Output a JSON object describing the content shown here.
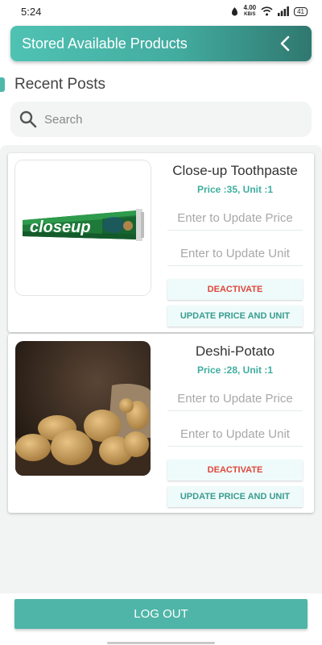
{
  "status_bar": {
    "time": "5:24",
    "speed_value": "4.00",
    "speed_unit": "KB/S",
    "battery": "41"
  },
  "header": {
    "title": "Stored Available Products"
  },
  "section": {
    "title": "Recent Posts"
  },
  "search": {
    "placeholder": "Search"
  },
  "products": [
    {
      "name": "Close-up Toothpaste",
      "meta": "Price :35, Unit :1",
      "price_placeholder": "Enter to Update Price",
      "unit_placeholder": "Enter to Update Unit",
      "deactivate_label": "DEACTIVATE",
      "update_label": "UPDATE PRICE AND UNIT",
      "image_text": "closeup"
    },
    {
      "name": "Deshi-Potato",
      "meta": "Price :28, Unit :1",
      "price_placeholder": "Enter to Update Price",
      "unit_placeholder": "Enter to Update Unit",
      "deactivate_label": "DEACTIVATE",
      "update_label": "UPDATE PRICE AND UNIT"
    }
  ],
  "footer": {
    "logout_label": "LOG OUT"
  },
  "colors": {
    "accent": "#4fb5a8",
    "danger": "#e0463a",
    "price_text": "#3fae9f"
  }
}
